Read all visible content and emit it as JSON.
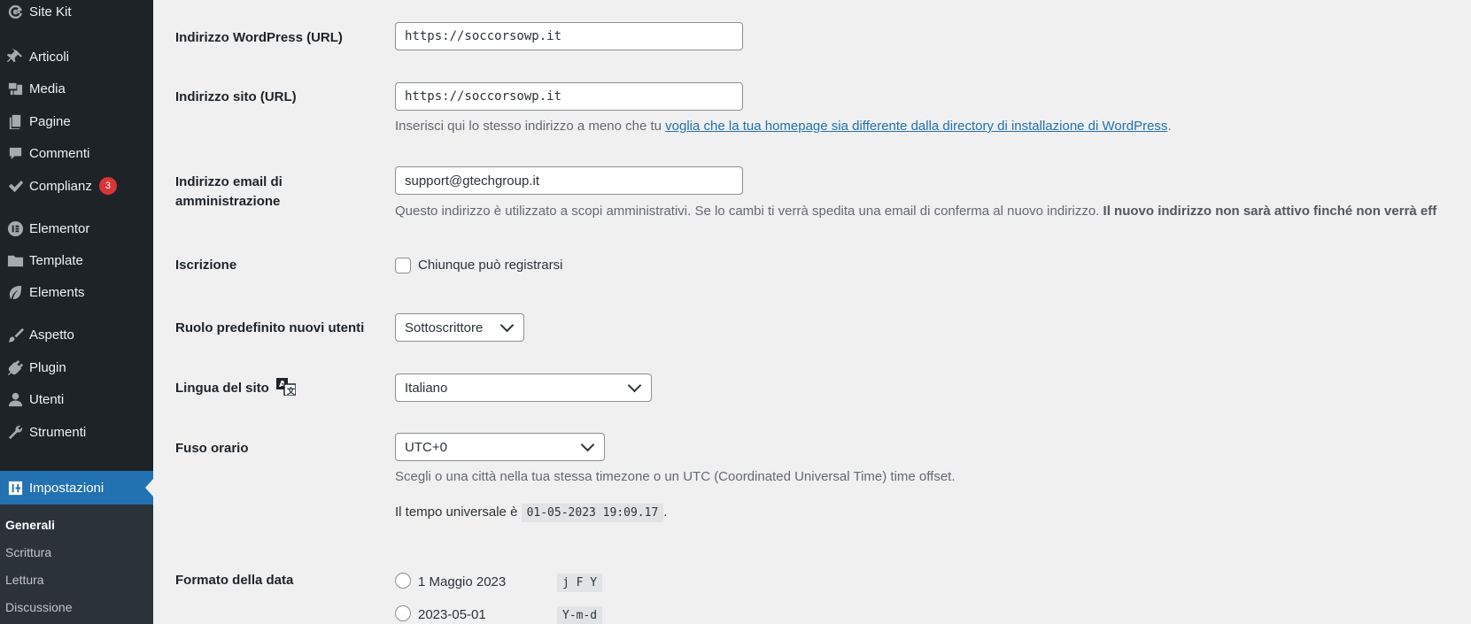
{
  "sidebar": {
    "items": [
      {
        "label": "Site Kit",
        "icon": "google-g-icon"
      },
      {
        "label": "Articoli",
        "icon": "pin-icon"
      },
      {
        "label": "Media",
        "icon": "media-icon"
      },
      {
        "label": "Pagine",
        "icon": "pages-icon"
      },
      {
        "label": "Commenti",
        "icon": "comment-icon"
      },
      {
        "label": "Complianz",
        "icon": "check-icon",
        "badge": "3"
      },
      {
        "label": "Elementor",
        "icon": "elementor-icon"
      },
      {
        "label": "Template",
        "icon": "folder-icon"
      },
      {
        "label": "Elements",
        "icon": "leaf-icon"
      },
      {
        "label": "Aspetto",
        "icon": "brush-icon"
      },
      {
        "label": "Plugin",
        "icon": "plug-icon"
      },
      {
        "label": "Utenti",
        "icon": "user-icon"
      },
      {
        "label": "Strumenti",
        "icon": "wrench-icon"
      },
      {
        "label": "Impostazioni",
        "icon": "settings-icon"
      }
    ],
    "submenu": [
      "Generali",
      "Scrittura",
      "Lettura",
      "Discussione"
    ]
  },
  "form": {
    "wp_url": {
      "label": "Indirizzo WordPress (URL)",
      "value": "https://soccorsowp.it"
    },
    "site_url": {
      "label": "Indirizzo sito (URL)",
      "value": "https://soccorsowp.it",
      "desc_prefix": "Inserisci qui lo stesso indirizzo a meno che tu ",
      "desc_link": "voglia che la tua homepage sia differente dalla directory di installazione di WordPress",
      "desc_suffix": "."
    },
    "admin_email": {
      "label_line1": "Indirizzo email di",
      "label_line2": "amministrazione",
      "value": "support@gtechgroup.it",
      "desc": "Questo indirizzo è utilizzato a scopi amministrativi. Se lo cambi ti verrà spedita una email di conferma al nuovo indirizzo. ",
      "desc_bold": "Il nuovo indirizzo non sarà attivo finché non verrà eff"
    },
    "membership": {
      "label": "Iscrizione",
      "checkbox_label": "Chiunque può registrarsi"
    },
    "default_role": {
      "label": "Ruolo predefinito nuovi utenti",
      "value": "Sottoscrittore"
    },
    "language": {
      "label": "Lingua del sito",
      "value": "Italiano"
    },
    "timezone": {
      "label": "Fuso orario",
      "value": "UTC+0",
      "desc": "Scegli o una città nella tua stessa timezone o un UTC (Coordinated Universal Time) time offset.",
      "universal_prefix": "Il tempo universale è ",
      "universal_time": "01-05-2023 19:09.17",
      "universal_suffix": "."
    },
    "date_format": {
      "label": "Formato della data",
      "options": [
        {
          "label": "1 Maggio 2023",
          "code": "j F Y"
        },
        {
          "label": "2023-05-01",
          "code": "Y-m-d"
        }
      ]
    }
  }
}
